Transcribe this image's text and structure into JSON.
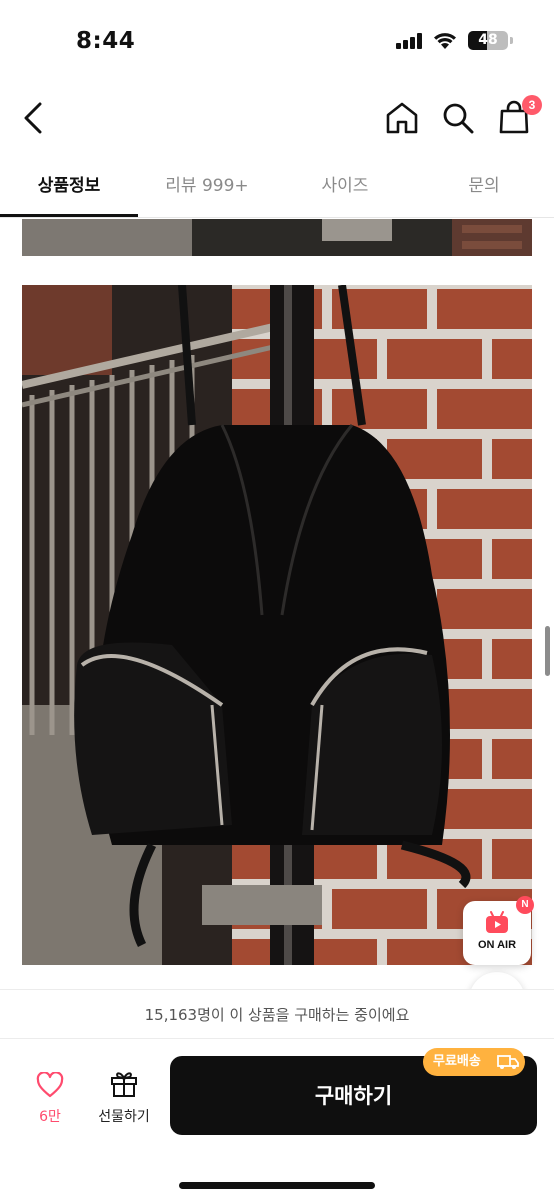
{
  "status_bar": {
    "time": "8:44",
    "battery_percent": 48,
    "battery_label": "48",
    "icons": [
      "signal-icon",
      "wifi-icon",
      "battery-icon"
    ]
  },
  "header": {
    "icons": [
      "back-arrow-icon",
      "home-icon",
      "search-icon",
      "shopping-bag-icon"
    ],
    "cart_badge": "3",
    "badge_color": "#ff5a6a"
  },
  "tabs": {
    "items": [
      {
        "label": "상품정보",
        "active": true
      },
      {
        "label": "리뷰 999+",
        "active": false
      },
      {
        "label": "사이즈",
        "active": false
      },
      {
        "label": "문의",
        "active": false
      }
    ]
  },
  "content": {
    "photo_subject": "black leather drawstring bucket backpack with zippered front pockets hanging on a railing against a red brick wall",
    "floating_buttons": {
      "up_icon": "arrow-up-icon",
      "down_icon": "arrow-down-icon",
      "on_air_label": "ON AIR",
      "on_air_badge": "N",
      "on_air_icon": "live-tv-icon"
    }
  },
  "buyers": {
    "text": "15,163명이 이 상품을 구매하는 중이에요"
  },
  "bottom_bar": {
    "like_count": "6만",
    "like_icon": "heart-icon",
    "gift_label": "선물하기",
    "gift_icon": "gift-icon",
    "buy_label": "구매하기",
    "free_shipping_label": "무료배송",
    "free_shipping_icon": "truck-icon",
    "accent_color": "#ffb23f",
    "heart_color": "#ff4b6e"
  }
}
